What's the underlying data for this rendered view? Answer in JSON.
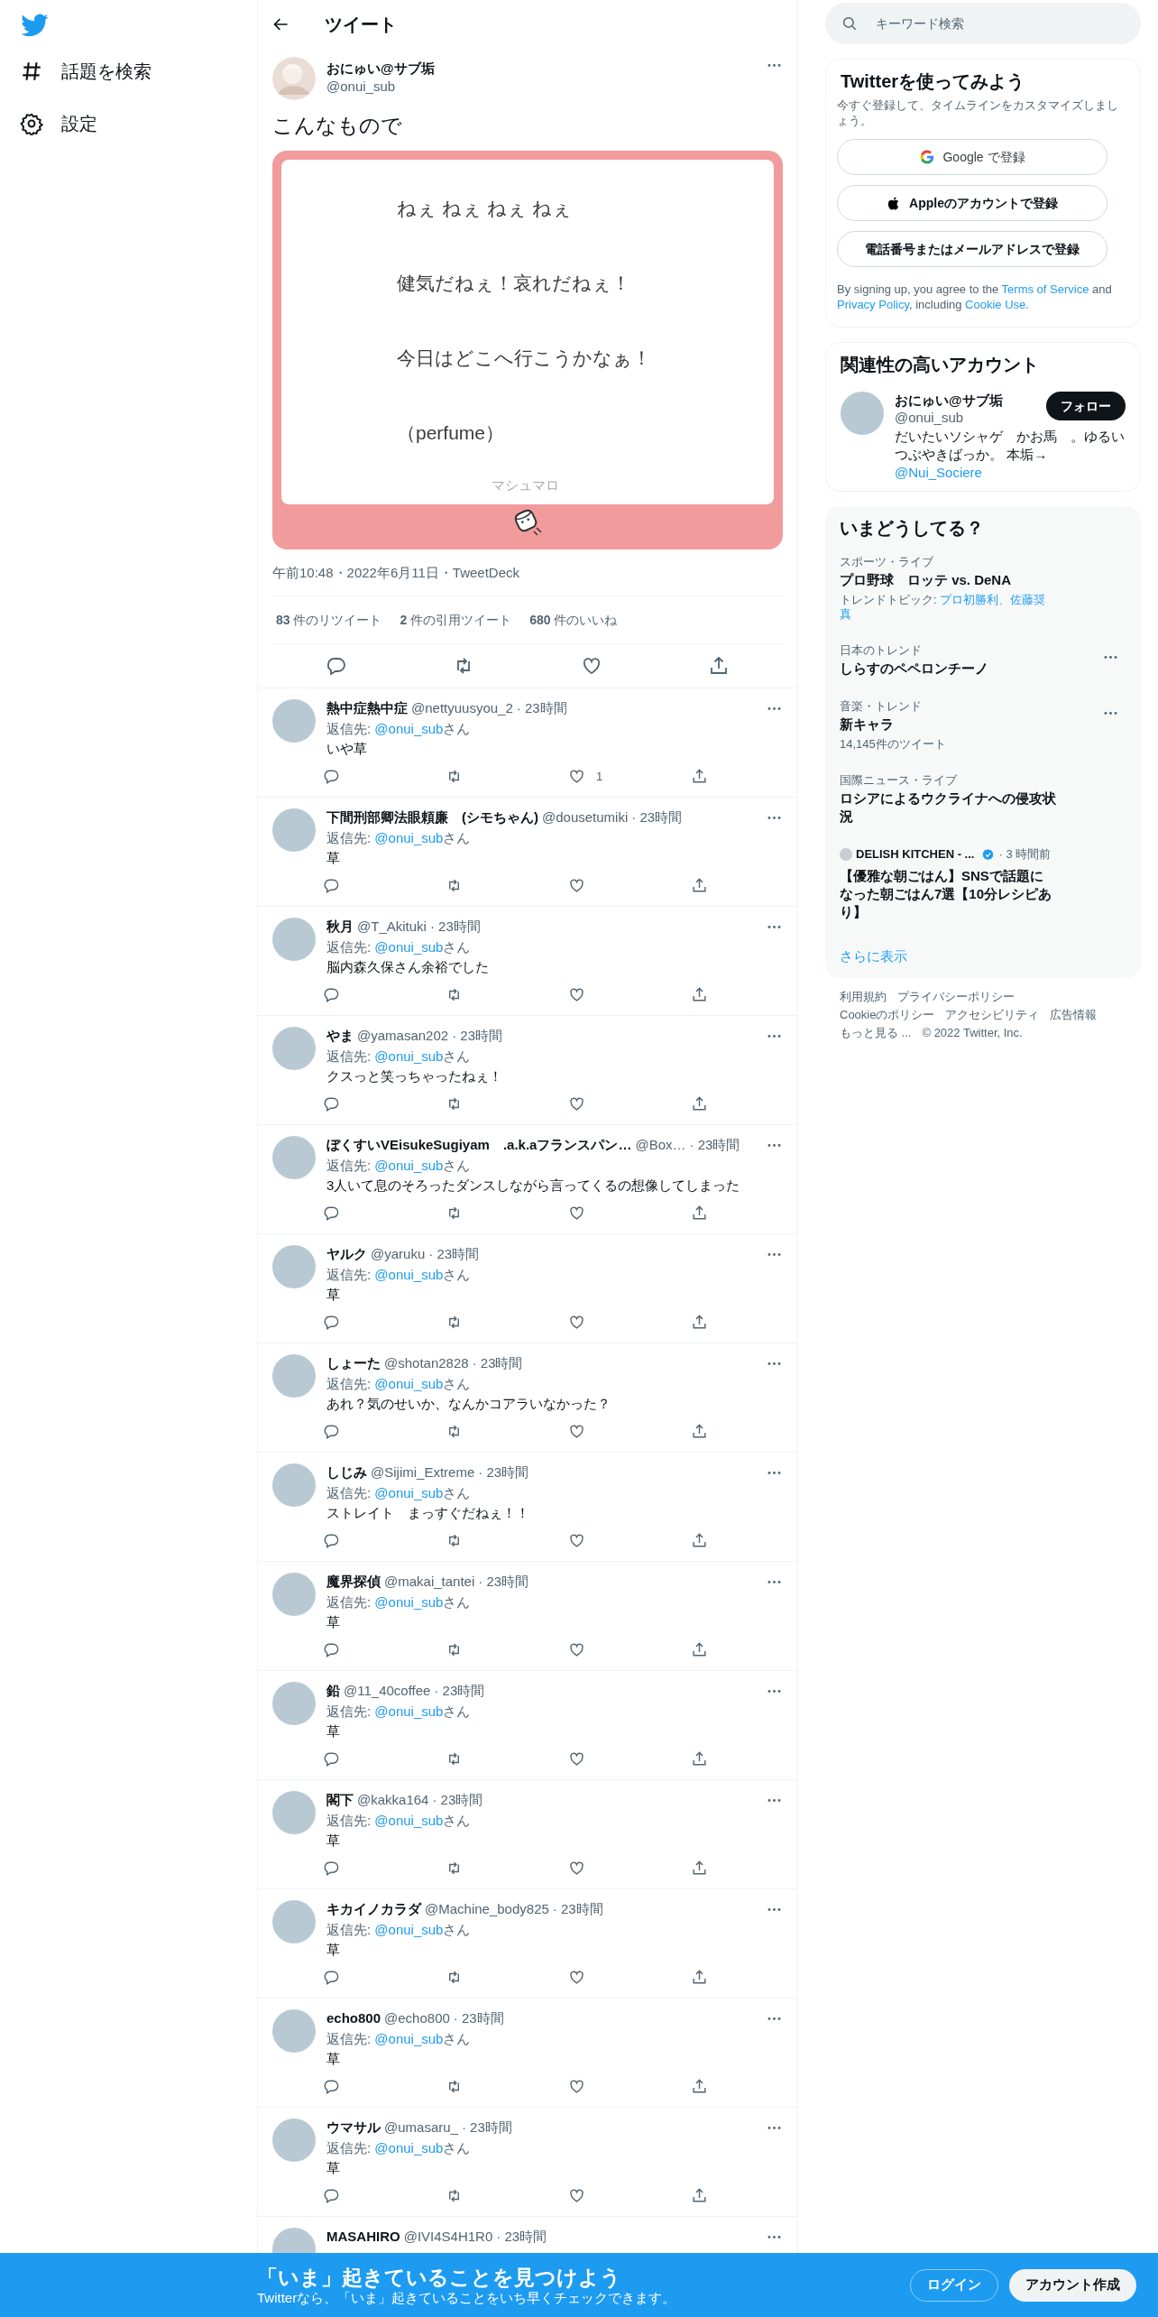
{
  "nav": {
    "items": [
      {
        "label": "話題を検索"
      },
      {
        "label": "設定"
      }
    ]
  },
  "header": {
    "title": "ツイート"
  },
  "tweet": {
    "name": "おにゅい@サブ垢",
    "handle": "@onui_sub",
    "text": "こんなもので",
    "card": {
      "lines": [
        "ねぇ ねぇ ねぇ ねぇ",
        "健気だねぇ！哀れだねぇ！",
        "今日はどこへ行こうかなぁ！",
        "（perfume）"
      ],
      "brand": "マシュマロ"
    },
    "meta": "午前10:48・2022年6月11日・TweetDeck",
    "stats": [
      "**83** 件のリツイート",
      "**2** 件の引用ツイート",
      "**680** 件のいいね"
    ]
  },
  "replies": [
    {
      "name": "熱中症熱中症",
      "handle": "@nettyuusyou_2",
      "time": "· 23時間",
      "reply_to": {
        "label": "返信先:",
        "handle": "@onui_sub",
        "suffix": "さん"
      },
      "text": "いや草",
      "like_count": "1"
    },
    {
      "name": "下間刑部卿法眼頼廉　(シモちゃん)",
      "handle": "@dousetumiki",
      "time": "· 23時間",
      "reply_to": {
        "label": "返信先:",
        "handle": "@onui_sub",
        "suffix": "さん"
      },
      "text": "草"
    },
    {
      "name": "秋月",
      "handle": "@T_Akituki",
      "time": "· 23時間",
      "reply_to": {
        "label": "返信先:",
        "handle": "@onui_sub",
        "suffix": "さん"
      },
      "text": "脳内森久保さん余裕でした"
    },
    {
      "name": "やま",
      "handle": "@yamasan202",
      "time": "· 23時間",
      "reply_to": {
        "label": "返信先:",
        "handle": "@onui_sub",
        "suffix": "さん"
      },
      "text": "クスっと笑っちゃったねぇ！"
    },
    {
      "name": "ぼくすいVEisukeSugiyam　.a.k.aフランスパン…",
      "handle": "@Box…",
      "time": "· 23時間",
      "reply_to": {
        "label": "返信先:",
        "handle": "@onui_sub",
        "suffix": "さん"
      },
      "text": "3人いて息のそろったダンスしながら言ってくるの想像してしまった"
    },
    {
      "name": "ヤルク",
      "handle": "@yaruku",
      "time": "· 23時間",
      "reply_to": {
        "label": "返信先:",
        "handle": "@onui_sub",
        "suffix": "さん"
      },
      "text": "草"
    },
    {
      "name": "しょーた",
      "handle": "@shotan2828",
      "time": "· 23時間",
      "reply_to": {
        "label": "返信先:",
        "handle": "@onui_sub",
        "suffix": "さん"
      },
      "text": "あれ？気のせいか、なんかコアラいなかった？"
    },
    {
      "name": "しじみ",
      "handle": "@Sijimi_Extreme",
      "time": "· 23時間",
      "reply_to": {
        "label": "返信先:",
        "handle": "@onui_sub",
        "suffix": "さん"
      },
      "text": "ストレイト　まっすぐだねぇ！！"
    },
    {
      "name": "魔界探偵",
      "handle": "@makai_tantei",
      "time": "· 23時間",
      "reply_to": {
        "label": "返信先:",
        "handle": "@onui_sub",
        "suffix": "さん"
      },
      "text": "草"
    },
    {
      "name": "鉛",
      "handle": "@11_40coffee",
      "time": "· 23時間",
      "reply_to": {
        "label": "返信先:",
        "handle": "@onui_sub",
        "suffix": "さん"
      },
      "text": "草"
    },
    {
      "name": "閣下",
      "handle": "@kakka164",
      "time": "· 23時間",
      "reply_to": {
        "label": "返信先:",
        "handle": "@onui_sub",
        "suffix": "さん"
      },
      "text": "草"
    },
    {
      "name": "キカイノカラダ",
      "handle": "@Machine_body825",
      "time": "· 23時間",
      "reply_to": {
        "label": "返信先:",
        "handle": "@onui_sub",
        "suffix": "さん"
      },
      "text": "草"
    },
    {
      "name": "echo800",
      "handle": "@echo800",
      "time": "· 23時間",
      "reply_to": {
        "label": "返信先:",
        "handle": "@onui_sub",
        "suffix": "さん"
      },
      "text": "草"
    },
    {
      "name": "ウマサル",
      "handle": "@umasaru_",
      "time": "· 23時間",
      "reply_to": {
        "label": "返信先:",
        "handle": "@onui_sub",
        "suffix": "さん"
      },
      "text": "草"
    },
    {
      "name": "MASAHIRO",
      "handle": "@IVI4S4H1R0",
      "time": "· 23時間"
    }
  ],
  "search": {
    "placeholder": "キーワード検索"
  },
  "signup": {
    "title": "Twitterを使ってみよう",
    "description": "今すぐ登録して、タイムラインをカスタマイズしましょう。",
    "buttons": [
      {
        "kind": "google",
        "label": "Google で登録"
      },
      {
        "kind": "apple",
        "label": "Appleのアカウントで登録"
      },
      {
        "kind": "plain",
        "label": "電話番号またはメールアドレスで登録"
      }
    ],
    "legal": [
      {
        "text": "By signing up, you agree to the ",
        "link": false
      },
      {
        "text": "Terms of Service",
        "link": true
      },
      {
        "text": " and ",
        "link": false
      },
      {
        "text": "Privacy Policy",
        "link": true
      },
      {
        "text": ", including ",
        "link": false
      },
      {
        "text": "Cookie Use.",
        "link": true
      }
    ]
  },
  "related": {
    "title": "関連性の高いアカウント",
    "accounts": [
      {
        "name": "おにゅい@サブ垢",
        "handle": "@onui_sub",
        "bio": "だいたいソシャゲ　かお馬　。ゆるいつぶやきばっか。 本垢→",
        "bio_link": "@Nui_Sociere",
        "follow": "フォロー"
      }
    ]
  },
  "trends": {
    "title": "いまどうしてる？",
    "items": [
      {
        "kind": "trend",
        "category": "スポーツ・ライブ",
        "title": "プロ野球　ロッテ vs. DeNA",
        "topics_label": "トレンドトピック:",
        "topics": "プロ初勝利、佐藤奨真",
        "menu": false
      },
      {
        "kind": "trend",
        "category": "日本のトレンド",
        "title": "しらすのペペロンチーノ",
        "menu": true
      },
      {
        "kind": "trend",
        "category": "音楽・トレンド",
        "title": "新キャラ",
        "count": "14,145件のツイート",
        "menu": true
      },
      {
        "kind": "trend",
        "category": "国際ニュース・ライブ",
        "title": "ロシアによるウクライナへの侵攻状況",
        "menu": false
      },
      {
        "kind": "news",
        "source": "DELISH KITCHEN - ...",
        "verified": true,
        "time": "· 3 時間前",
        "title": "【優雅な朝ごはん】SNSで話題になった朝ごはん7選【10分レシピあり】"
      }
    ],
    "more": "さらに表示"
  },
  "footer": [
    "利用規約",
    "プライバシーポリシー",
    "Cookieのポリシー",
    "アクセシビリティ",
    "広告情報",
    "もっと見る ...",
    "© 2022 Twitter, Inc."
  ],
  "bottom_bar": {
    "title": "「いま」起きていることを見つけよう",
    "subtitle": "Twitterなら、「いま」起きていることをいち早くチェックできます。",
    "login": "ログイン",
    "signup": "アカウント作成"
  }
}
